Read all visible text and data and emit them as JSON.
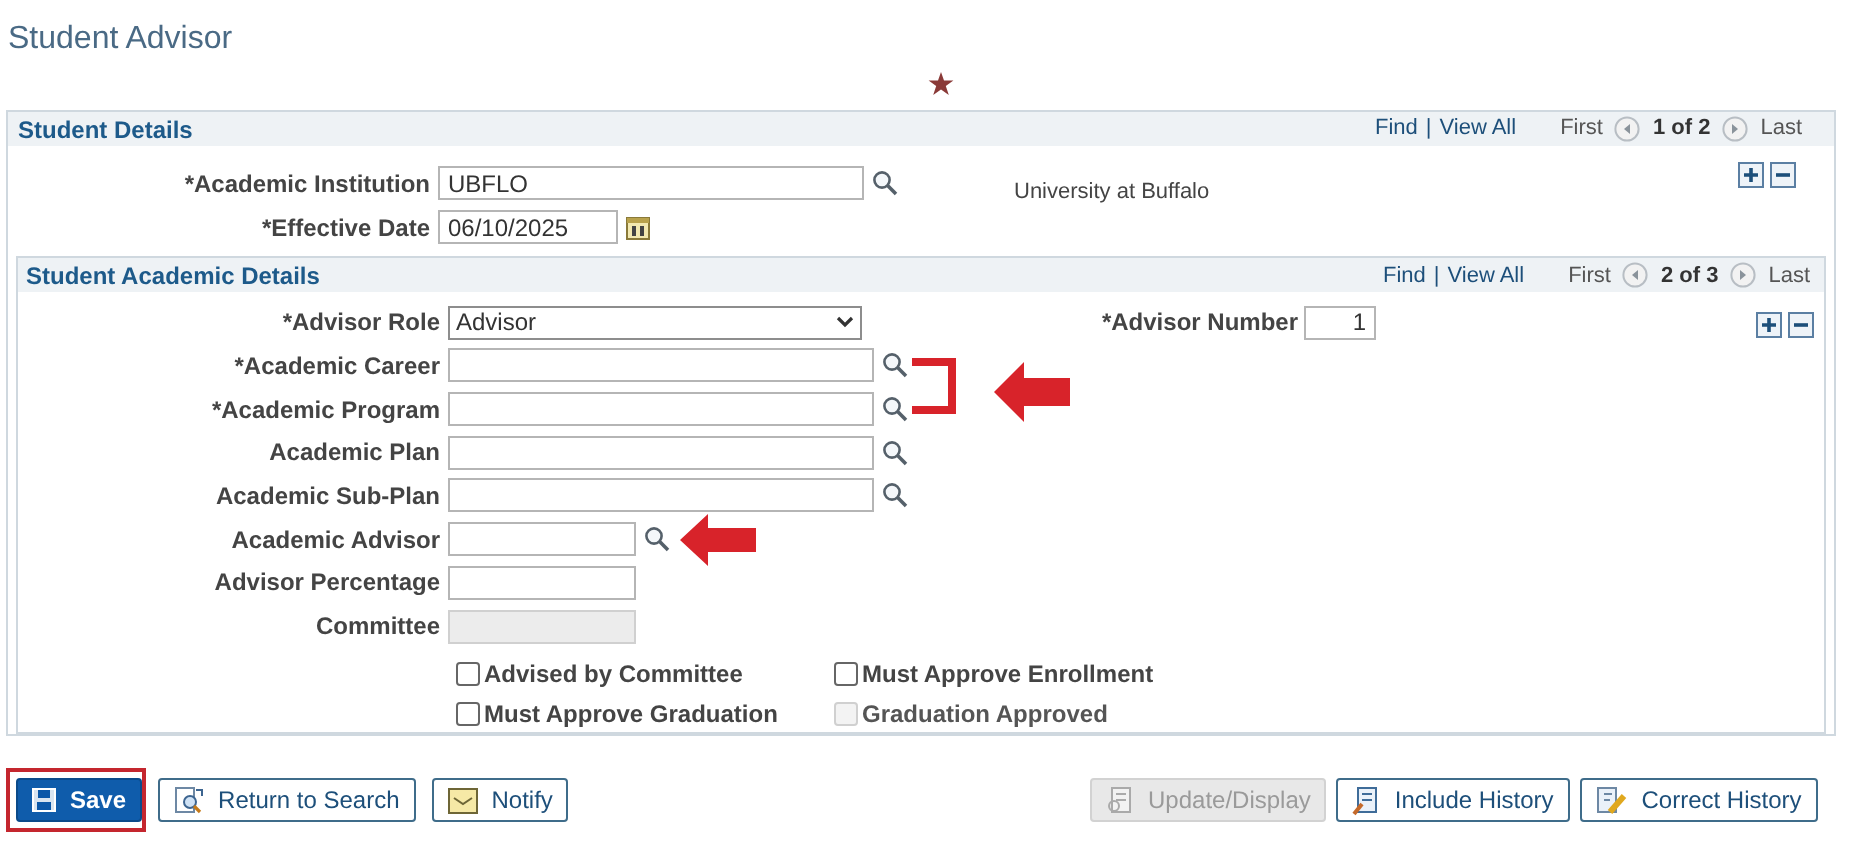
{
  "page_title": "Student Advisor",
  "student_details": {
    "title": "Student Details",
    "find": "Find",
    "separator": "|",
    "view_all": "View All",
    "first": "First",
    "counter": "1 of 2",
    "last": "Last",
    "institution": {
      "label": "*Academic Institution",
      "value": "UBFLO",
      "description": "University at Buffalo"
    },
    "effective_date": {
      "label": "*Effective Date",
      "value": "06/10/2025"
    }
  },
  "academic_details": {
    "title": "Student Academic Details",
    "find": "Find",
    "separator": "|",
    "view_all": "View All",
    "first": "First",
    "counter": "2 of 3",
    "last": "Last",
    "advisor_role": {
      "label": "*Advisor Role",
      "value": "Advisor"
    },
    "advisor_number": {
      "label": "*Advisor Number",
      "value": "1"
    },
    "fields": [
      {
        "label": "*Academic Career",
        "kind": "lookup"
      },
      {
        "label": "*Academic Program",
        "kind": "lookup"
      },
      {
        "label": "Academic Plan",
        "kind": "lookup"
      },
      {
        "label": "Academic Sub-Plan",
        "kind": "lookup"
      },
      {
        "label": "Academic Advisor",
        "kind": "short-lookup"
      },
      {
        "label": "Advisor Percentage",
        "kind": "text"
      },
      {
        "label": "Committee",
        "kind": "readonly"
      }
    ],
    "checkboxes": [
      {
        "label": "Advised by Committee",
        "checked": false,
        "disabled": false
      },
      {
        "label": "Must Approve Enrollment",
        "checked": false,
        "disabled": false
      },
      {
        "label": "Must Approve Graduation",
        "checked": false,
        "disabled": false
      },
      {
        "label": "Graduation Approved",
        "checked": false,
        "disabled": true
      }
    ]
  },
  "buttons_left": [
    {
      "label": "Save",
      "kind": "primary"
    },
    {
      "label": "Return to Search",
      "kind": "return"
    },
    {
      "label": "Notify",
      "kind": "notify"
    }
  ],
  "buttons_right": [
    {
      "label": "Update/Display",
      "kind": "update",
      "disabled": true
    },
    {
      "label": "Include History",
      "kind": "include",
      "disabled": false
    },
    {
      "label": "Correct History",
      "kind": "correct",
      "disabled": false
    }
  ]
}
